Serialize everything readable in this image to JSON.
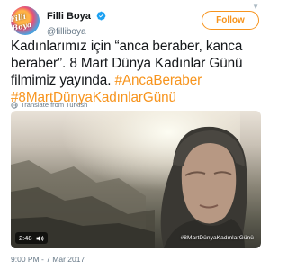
{
  "header": {
    "avatar_text": "Filli Boya",
    "display_name": "Filli Boya",
    "handle": "@filliboya",
    "follow_label": "Follow",
    "verified_icon": "verified-badge-icon",
    "menu_icon": "chevron-down-icon"
  },
  "tweet": {
    "line1": "Kadınlarımız için “anca beraber, kanca",
    "line2": "beraber”. 8 Mart Dünya Kadınlar Günü",
    "line3_text": "filmimiz yayında. ",
    "line3_hashtag": "#AncaBeraber",
    "line4_hashtag": "#8MartDünyaKadınlarGünü"
  },
  "translate": {
    "label": "Translate from Turkish",
    "icon": "globe-icon"
  },
  "video": {
    "duration": "2:48",
    "watermark": "#8MartDünyaKadınlarGünü",
    "volume_icon": "volume-icon"
  },
  "timestamp": "9:00 PM - 7 Mar 2017",
  "colors": {
    "accent": "#f7941d",
    "text": "#14171a",
    "muted": "#657786",
    "verified": "#1da1f2"
  }
}
